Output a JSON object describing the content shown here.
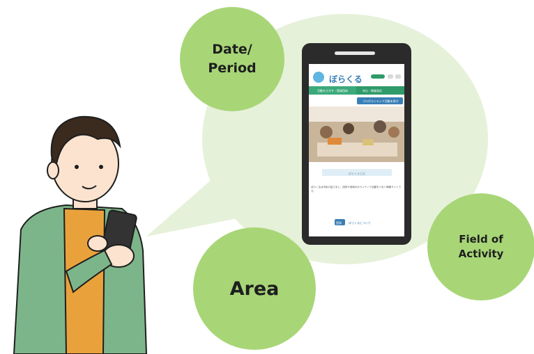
{
  "bubbles": {
    "date": "Date/\nPeriod",
    "field": "Field of\nActivity",
    "area": "Area"
  },
  "phone": {
    "app_title": "ぼらくる",
    "nav_tab_1": "活動をさがす・登録団体",
    "nav_tab_2": "申込・情報発信",
    "search_button": "プロボランティア活動を探す",
    "section_heading": "ぼらくるとは",
    "body_text": "ぼらくるは市民の皆さまと、団体や地域のボランティア活動をつなぐ情報サイトです。",
    "action_button": "登録",
    "action_link": "ぼらくるについて"
  },
  "colors": {
    "bubble_green": "#a8d677",
    "speech_bubble": "#e6f1d9",
    "phone_body": "#2b2b2b",
    "app_accent": "#2f9a6a",
    "app_blue": "#3a7fb5",
    "shirt": "#e9a23b",
    "jacket": "#7db58a"
  }
}
